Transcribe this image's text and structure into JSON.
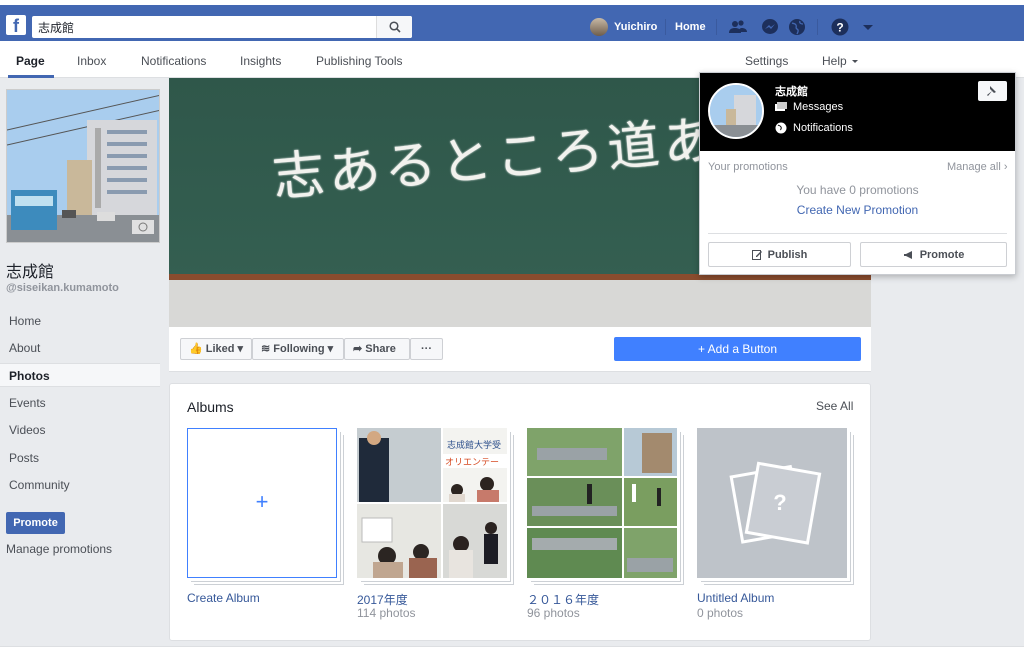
{
  "header": {
    "search_value": "志成館",
    "user_name": "Yuichiro",
    "home_label": "Home",
    "brand_color": "#4267b2"
  },
  "page_nav": {
    "tabs": [
      "Page",
      "Inbox",
      "Notifications",
      "Insights",
      "Publishing Tools"
    ],
    "settings": "Settings",
    "help": "Help"
  },
  "page": {
    "name": "志成館",
    "handle": "@siseikan.kumamoto",
    "cover_text": "志あるところ道あり"
  },
  "left_nav": {
    "items": [
      "Home",
      "About",
      "Photos",
      "Events",
      "Videos",
      "Posts",
      "Community"
    ],
    "active": "Photos",
    "promote": "Promote",
    "manage_promotions": "Manage promotions"
  },
  "actions": {
    "liked": "Liked",
    "following": "Following",
    "share": "Share",
    "more": "···",
    "add_button": "Add a Button"
  },
  "albums": {
    "title": "Albums",
    "see_all": "See All",
    "create": "Create Album",
    "items": [
      {
        "name": "2017年度",
        "count": "114 photos"
      },
      {
        "name": "２０１６年度",
        "count": "96 photos"
      },
      {
        "name": "Untitled Album",
        "count": "0 photos"
      }
    ]
  },
  "popup": {
    "name": "志成館",
    "messages": "Messages",
    "notifications": "Notifications",
    "your_promotions": "Your promotions",
    "manage_all": "Manage all ›",
    "zero": "You have 0 promotions",
    "create": "Create New Promotion",
    "publish": "Publish",
    "promote": "Promote"
  }
}
